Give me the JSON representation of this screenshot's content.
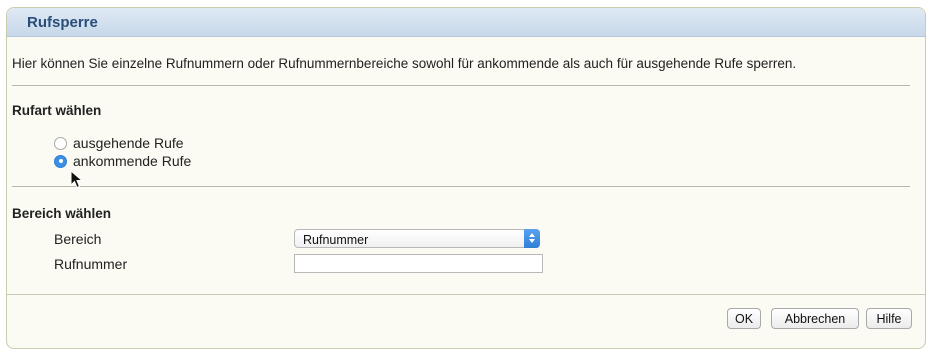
{
  "header": {
    "title": "Rufsperre"
  },
  "intro_text": "Hier können Sie einzelne Rufnummern oder Rufnummernbereiche sowohl für ankommende als auch für ausgehende Rufe sperren.",
  "call_type": {
    "title": "Rufart wählen",
    "options": [
      {
        "label": "ausgehende Rufe",
        "checked": false
      },
      {
        "label": "ankommende Rufe",
        "checked": true
      }
    ]
  },
  "range": {
    "title": "Bereich wählen",
    "bereich_label": "Bereich",
    "bereich_selected": "Rufnummer",
    "rufnummer_label": "Rufnummer",
    "rufnummer_value": ""
  },
  "buttons": {
    "ok": "OK",
    "cancel": "Abbrechen",
    "help": "Hilfe"
  },
  "colors": {
    "header_title": "#2a4e7a",
    "accent": "#3a8ee6",
    "panel_bg": "#fbfbf3"
  },
  "icons": {
    "cursor": "mouse-pointer-icon",
    "select_arrows": "chevron-up-down-icon"
  }
}
